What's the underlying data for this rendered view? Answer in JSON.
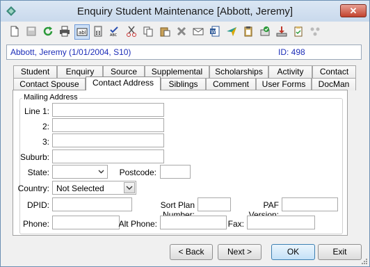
{
  "window": {
    "title": "Enquiry Student Maintenance  [Abbott, Jeremy]",
    "close_glyph": "✕",
    "accent_color": "#1c2db8"
  },
  "toolbar": {
    "icons": [
      "new-document-icon",
      "save-icon",
      "refresh-icon",
      "print-icon",
      "text-field-icon",
      "calculator-icon",
      "spell-check-icon",
      "cut-icon",
      "copy-icon",
      "paste-icon",
      "delete-icon",
      "email-icon",
      "word-export-icon",
      "send-icon",
      "clipboard-icon",
      "approve-icon",
      "download-tray-icon",
      "checklist-icon",
      "merge-icon"
    ]
  },
  "info": {
    "student": "Abbott, Jeremy (1/01/2004, S10)",
    "id": "ID: 498"
  },
  "tabs": {
    "row1": [
      "Student",
      "Enquiry",
      "Source",
      "Supplemental",
      "Scholarships",
      "Activity",
      "Contact"
    ],
    "row2": [
      "Contact Spouse",
      "Contact Address",
      "Siblings",
      "Comment",
      "User Forms",
      "DocMan"
    ],
    "active": "Contact Address"
  },
  "form": {
    "group_title": "Mailing Address",
    "line1_label": "Line 1:",
    "line2_label": "2:",
    "line3_label": "3:",
    "suburb_label": "Suburb:",
    "state_label": "State:",
    "postcode_label": "Postcode:",
    "country_label": "Country:",
    "country_value": "Not Selected",
    "dpid_label": "DPID:",
    "sort_plan_label": "Sort Plan Number:",
    "paf_label": "PAF Version:",
    "phone_label": "Phone:",
    "alt_phone_label": "Alt Phone:",
    "fax_label": "Fax:"
  },
  "buttons": {
    "back": "< Back",
    "next": "Next >",
    "ok": "OK",
    "exit": "Exit"
  }
}
